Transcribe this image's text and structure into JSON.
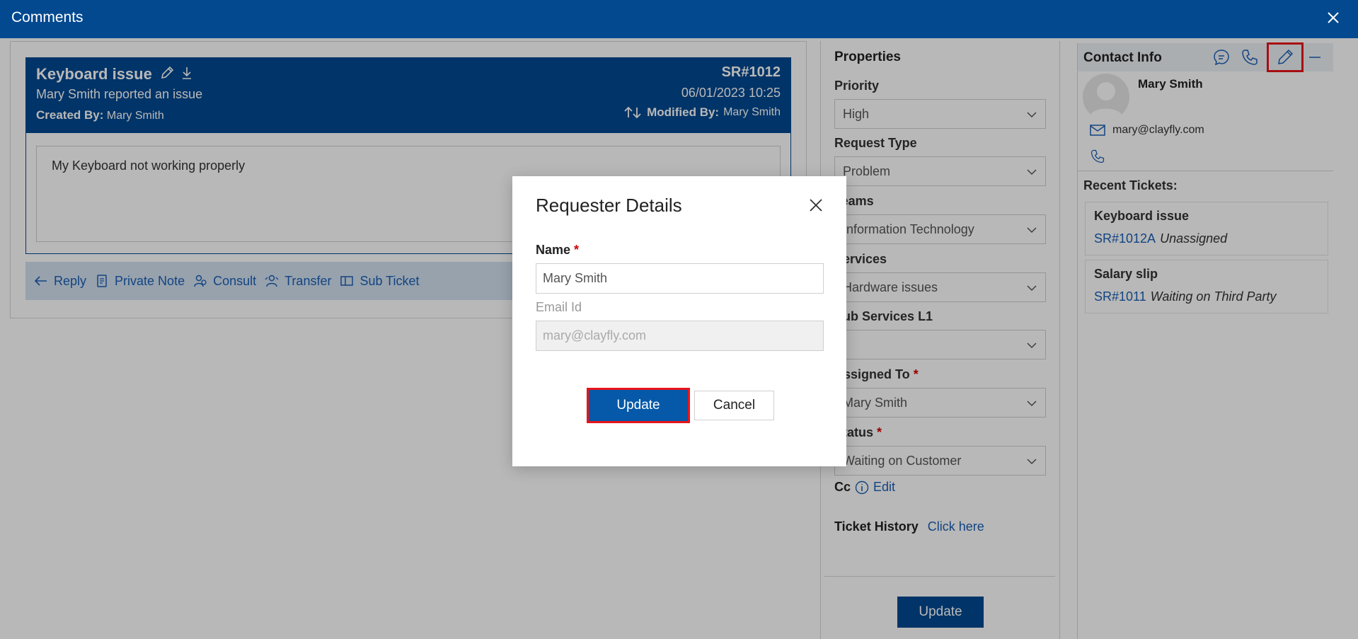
{
  "window": {
    "title": "Comments"
  },
  "ticket": {
    "title": "Keyboard issue",
    "subtitle": "Mary Smith reported an issue",
    "created_by_label": "Created By:",
    "created_by": "Mary Smith",
    "sr": "SR#1012",
    "date": "06/01/2023 10:25",
    "modified_by_label": "Modified By:",
    "modified_by": "Mary Smith",
    "body": "My Keyboard not working properly"
  },
  "actions": [
    {
      "label": "Reply",
      "icon": "arrow-left-icon"
    },
    {
      "label": "Private Note",
      "icon": "note-icon"
    },
    {
      "label": "Consult",
      "icon": "consult-icon"
    },
    {
      "label": "Transfer",
      "icon": "transfer-icon"
    },
    {
      "label": "Sub Ticket",
      "icon": "sub-ticket-icon"
    }
  ],
  "properties": {
    "title": "Properties",
    "priority_label": "Priority",
    "priority": "High",
    "request_type_label": "Request Type",
    "request_type": "Problem",
    "teams_label": "Teams",
    "teams": "Information Technology",
    "services_label": "Services",
    "services": "Hardware issues",
    "sub_services_label": "Sub Services L1",
    "sub_services": "",
    "assigned_to_label": "Assigned To",
    "assigned_to": "Mary Smith",
    "status_label": "Status",
    "status": "Waiting on Customer",
    "required_mark": "*",
    "cc_label": "Cc",
    "cc_edit": "Edit",
    "history_label": "Ticket History",
    "history_link": "Click here",
    "update_label": "Update"
  },
  "contact": {
    "title": "Contact Info",
    "name": "Mary Smith",
    "email": "mary@clayfly.com",
    "recent_label": "Recent Tickets:",
    "recent": [
      {
        "title": "Keyboard issue",
        "id": "SR#1012A",
        "status": "Unassigned"
      },
      {
        "title": "Salary slip",
        "id": "SR#1011",
        "status": "Waiting on Third Party"
      }
    ]
  },
  "modal": {
    "title": "Requester Details",
    "name_label": "Name",
    "required_mark": "*",
    "name_value": "Mary Smith",
    "email_label": "Email Id",
    "email_value": "mary@clayfly.com",
    "update_label": "Update",
    "cancel_label": "Cancel"
  },
  "colors": {
    "brand": "#024990",
    "accent": "#1a5fb4",
    "highlight": "#e8141b"
  }
}
